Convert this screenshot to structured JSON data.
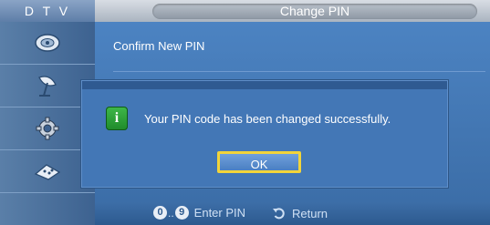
{
  "header": {
    "source": "D T V",
    "title": "Change PIN"
  },
  "sidebar": {
    "items": [
      {
        "icon": "satellite-dish-icon"
      },
      {
        "icon": "antenna-icon"
      },
      {
        "icon": "gear-icon"
      },
      {
        "icon": "remote-control-icon"
      }
    ]
  },
  "main": {
    "label": "Confirm New PIN"
  },
  "dialog": {
    "icon": "info-icon",
    "icon_glyph": "i",
    "message": "Your PIN code has been changed successfully.",
    "ok_label": "OK"
  },
  "footer": {
    "key_start": "0",
    "key_sep": "..",
    "key_end": "9",
    "enter_label": "Enter PIN",
    "return_icon": "return-arrow-icon",
    "return_label": "Return"
  },
  "colors": {
    "accent_focus": "#f2d43a",
    "info_green": "#2a9e35"
  }
}
